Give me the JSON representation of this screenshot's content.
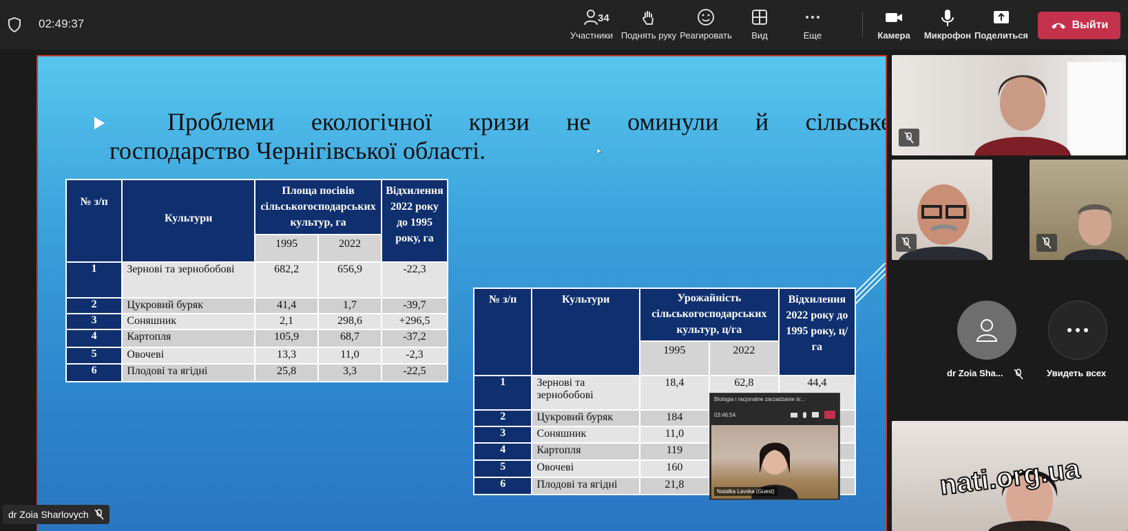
{
  "topbar": {
    "time": "02:49:37",
    "participants_count": "34",
    "buttons": {
      "participants": "Участники",
      "raise_hand": "Поднять руку",
      "react": "Реагировать",
      "view": "Вид",
      "more": "Еще",
      "camera": "Камера",
      "mic": "Микрофон",
      "share": "Поделиться",
      "leave": "Выйти"
    }
  },
  "slide": {
    "headline_line1": "Проблеми екологічної кризи не оминули й сільське",
    "headline_line2": "господарство Чернігівської області.",
    "table1": {
      "h_num": "№ з/п",
      "h_crop": "Культури",
      "h_area": "Площа посівів сільськогосподарських культур, га",
      "h_dev": "Відхилення 2022 року до 1995 року, га",
      "y1": "1995",
      "y2": "2022",
      "rows": [
        {
          "n": "1",
          "crop": "Зернові та зернобобові",
          "a": "682,2",
          "b": "656,9",
          "d": "-22,3"
        },
        {
          "n": "2",
          "crop": "Цукровий буряк",
          "a": "41,4",
          "b": "1,7",
          "d": "-39,7"
        },
        {
          "n": "3",
          "crop": "Соняшник",
          "a": "2,1",
          "b": "298,6",
          "d": "+296,5"
        },
        {
          "n": "4",
          "crop": "Картопля",
          "a": "105,9",
          "b": "68,7",
          "d": "-37,2"
        },
        {
          "n": "5",
          "crop": "Овочеві",
          "a": "13,3",
          "b": "11,0",
          "d": "-2,3"
        },
        {
          "n": "6",
          "crop": "Плодові та ягідні",
          "a": "25,8",
          "b": "3,3",
          "d": "-22,5"
        }
      ]
    },
    "table2": {
      "h_num": "№ з/п",
      "h_crop": "Культури",
      "h_yield": "Урожайність сільськогосподарських культур, ц/га",
      "h_dev": "Відхилення 2022 року до 1995 року, ц/га",
      "y1": "1995",
      "y2": "2022",
      "rows": [
        {
          "n": "1",
          "crop": "Зернові та зернобобові",
          "a": "18,4",
          "b": "62,8",
          "d": "44,4"
        },
        {
          "n": "2",
          "crop": "Цукровий буряк",
          "a": "184",
          "b": "",
          "d": ""
        },
        {
          "n": "3",
          "crop": "Соняшник",
          "a": "11,0",
          "b": "",
          "d": ""
        },
        {
          "n": "4",
          "crop": "Картопля",
          "a": "119",
          "b": "",
          "d": ""
        },
        {
          "n": "5",
          "crop": "Овочеві",
          "a": "160",
          "b": "",
          "d": ""
        },
        {
          "n": "6",
          "crop": "Плодові та ягідні",
          "a": "21,8",
          "b": "",
          "d": ""
        }
      ]
    }
  },
  "mini_window": {
    "title": "Biologia i racjonalne zarzadzanie śr...",
    "time": "03:46:54",
    "name": "Natalka Lavska (Guest)"
  },
  "speaker_name": "dr Zoia Sharlovych",
  "gallery": {
    "zoia_label": "dr Zoia Sha...",
    "see_all": "Увидеть всех",
    "watermark": "nati.org.ua"
  },
  "colors": {
    "leave": "#c4314b",
    "table_header": "#0f2f6e",
    "slide_top": "#58c6ee",
    "slide_bottom": "#2a76c3"
  }
}
